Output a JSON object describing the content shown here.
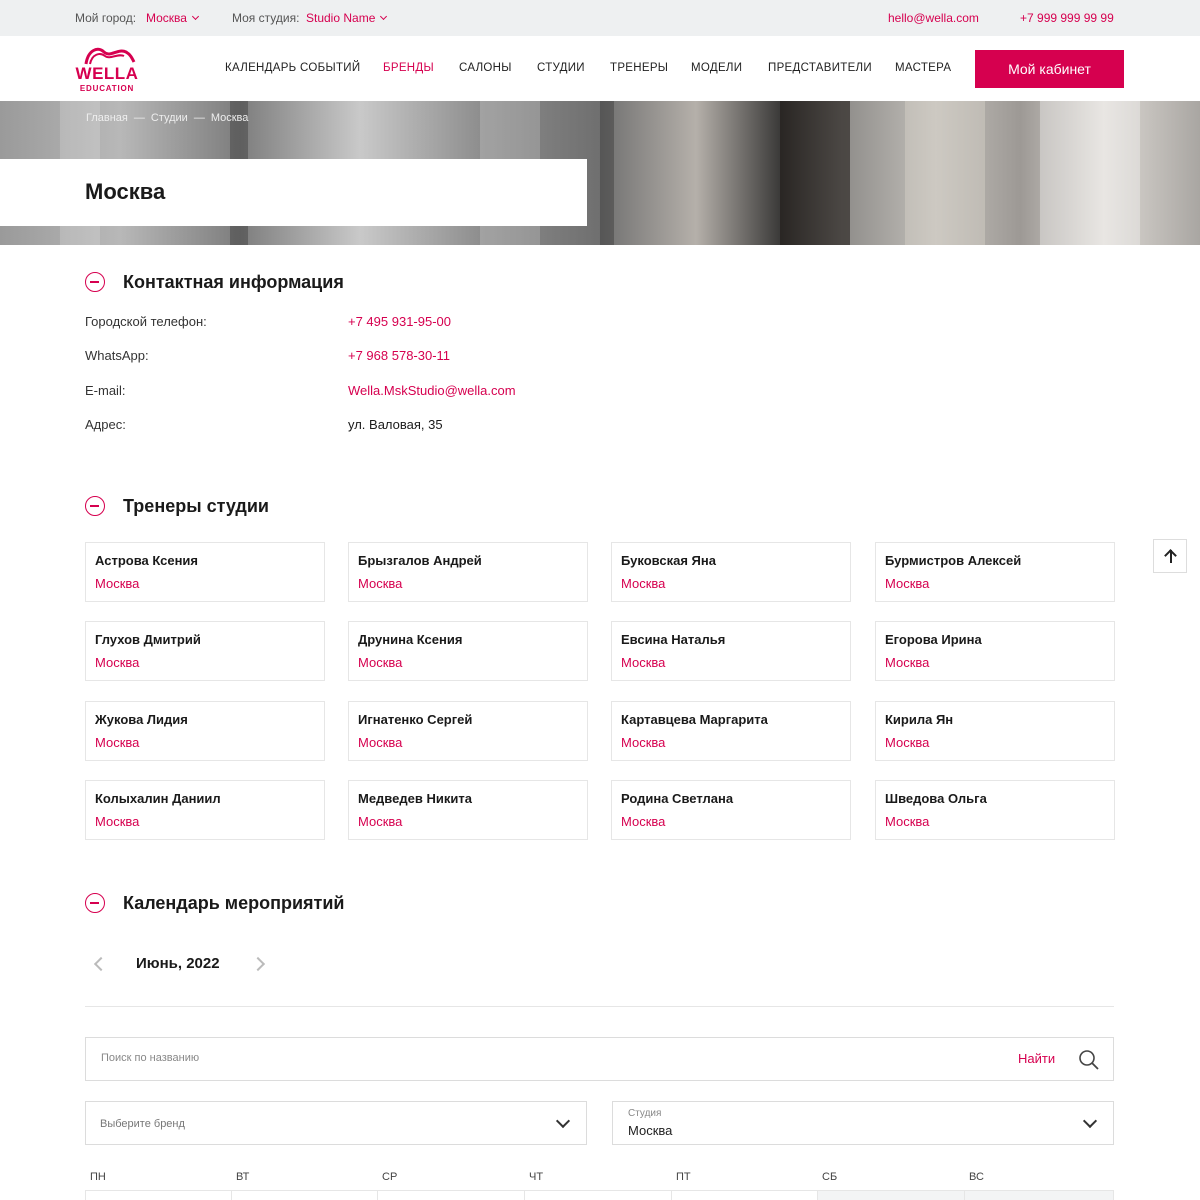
{
  "topbar": {
    "city_label": "Мой город:",
    "city_value": "Москва",
    "studio_label": "Моя студия:",
    "studio_value": "Studio Name",
    "email": "hello@wella.com",
    "phone": "+7 999 999 99 99"
  },
  "logo": {
    "title": "WELLA",
    "subtitle": "EDUCATION"
  },
  "nav": {
    "items": [
      {
        "label": "КАЛЕНДАРЬ СОБЫТИЙ"
      },
      {
        "label": "БРЕНДЫ"
      },
      {
        "label": "САЛОНЫ"
      },
      {
        "label": "СТУДИИ"
      },
      {
        "label": "ТРЕНЕРЫ"
      },
      {
        "label": "МОДЕЛИ"
      },
      {
        "label": "ПРЕДСТАВИТЕЛИ"
      },
      {
        "label": "МАСТЕРА"
      }
    ],
    "active": "БРЕНДЫ",
    "cabinet_label": "Мой кабинет"
  },
  "breadcrumb": {
    "items": [
      "Главная",
      "Студии",
      "Москва"
    ],
    "separator": "—"
  },
  "page": {
    "title": "Москва"
  },
  "contacts": {
    "title": "Контактная информация",
    "rows": [
      {
        "label": "Городской телефон:",
        "value": "+7 495 931-95-00"
      },
      {
        "label": "WhatsApp:",
        "value": "+7 968 578-30-11"
      },
      {
        "label": "E-mail:",
        "value": "Wella.MskStudio@wella.com"
      },
      {
        "label": "Адрес:",
        "value": "ул. Валовая, 35"
      }
    ]
  },
  "trainers": {
    "title": "Тренеры студии",
    "items": [
      {
        "name": "Астрова Ксения",
        "city": "Москва"
      },
      {
        "name": "Брызгалов Андрей",
        "city": "Москва"
      },
      {
        "name": "Буковская Яна",
        "city": "Москва"
      },
      {
        "name": "Бурмистров Алексей",
        "city": "Москва"
      },
      {
        "name": "Глухов Дмитрий",
        "city": "Москва"
      },
      {
        "name": "Друнина Ксения",
        "city": "Москва"
      },
      {
        "name": "Евсина Наталья",
        "city": "Москва"
      },
      {
        "name": "Егорова Ирина",
        "city": "Москва"
      },
      {
        "name": "Жукова Лидия",
        "city": "Москва"
      },
      {
        "name": "Игнатенко Сергей",
        "city": "Москва"
      },
      {
        "name": "Картавцева Маргарита",
        "city": "Москва"
      },
      {
        "name": "Кирила Ян",
        "city": "Москва"
      },
      {
        "name": "Колыхалин Даниил",
        "city": "Москва"
      },
      {
        "name": "Медведев Никита",
        "city": "Москва"
      },
      {
        "name": "Родина Светлана",
        "city": "Москва"
      },
      {
        "name": "Шведова Ольга",
        "city": "Москва"
      }
    ]
  },
  "calendar": {
    "title": "Календарь мероприятий",
    "month": "Июнь, 2022",
    "search_placeholder": "Поиск по названию",
    "search_button": "Найти",
    "brand_placeholder": "Выберите бренд",
    "studio_label": "Студия",
    "studio_value": "Москва",
    "weekdays": [
      "ПН",
      "ВТ",
      "СР",
      "ЧТ",
      "ПТ",
      "СБ",
      "ВС"
    ]
  },
  "colors": {
    "accent": "#d6004f",
    "topbar_bg": "#eef0f1",
    "border": "#e6e6e6"
  },
  "icons": {
    "collapse": "minus-circle-icon",
    "search": "search-icon",
    "scroll_top": "arrow-up-icon",
    "dropdown": "chevron-down-icon"
  }
}
